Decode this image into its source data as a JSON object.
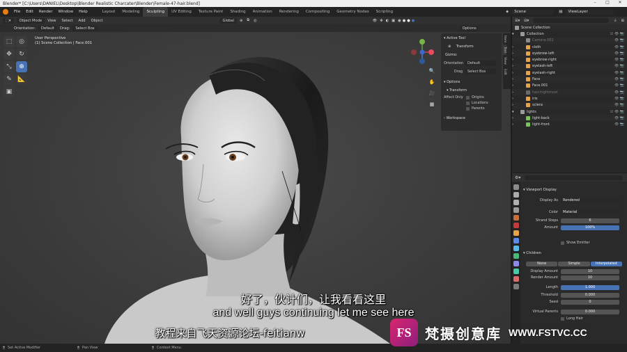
{
  "window": {
    "title": "Blender* [C:\\Users\\DANIEL\\Desktop\\Blender Realistic Charcater\\Blender\\Female-47-hair.blend]"
  },
  "menu": [
    "File",
    "Edit",
    "Render",
    "Window",
    "Help"
  ],
  "workspaces": [
    "Layout",
    "Modeling",
    "Sculpting",
    "UV Editing",
    "Texture Paint",
    "Shading",
    "Animation",
    "Rendering",
    "Compositing",
    "Geometry Nodes",
    "Scripting"
  ],
  "active_workspace": "Sculpting",
  "scene": {
    "scene_name": "Scene",
    "view_layer": "ViewLayer"
  },
  "viewport_header": {
    "mode": "Object Mode",
    "menus": [
      "View",
      "Select",
      "Add",
      "Object"
    ],
    "transform": "Global",
    "options": "Options",
    "orientation_label": "Orientation:",
    "orientation_value": "Default",
    "drag_label": "Drag:",
    "drag_value": "Select Box"
  },
  "viewport": {
    "perspective": "User Perspective",
    "collection": "(1) Scene Collection | Face.001"
  },
  "npanel": {
    "active_tool": "Active Tool",
    "transform": "Transform",
    "gizmo": "Gizmo:",
    "orientation_label": "Orientation",
    "orientation_value": "Default",
    "drag_label": "Drag",
    "drag_value": "Select Box",
    "options": "Options",
    "transform2": "Transform",
    "affect_only": "Affect Only",
    "origins": "Origins",
    "locations": "Locations",
    "parents": "Parents",
    "workspace": "Workspace",
    "tabs": [
      "Item",
      "Tool",
      "View",
      "Edit"
    ]
  },
  "outliner": {
    "header": "Scene Collection",
    "items": [
      {
        "label": "Scene Collection",
        "indent": 0,
        "color": "#9a9a9a"
      },
      {
        "label": "Collection",
        "indent": 1,
        "color": "#9a9a9a"
      },
      {
        "label": "Camera.001",
        "indent": 2,
        "color": "#8a8a8a"
      },
      {
        "label": "cloth",
        "indent": 2,
        "color": "#e8a24a"
      },
      {
        "label": "eyebrow-left",
        "indent": 2,
        "color": "#e8a24a"
      },
      {
        "label": "eyebrow-right",
        "indent": 2,
        "color": "#e8a24a"
      },
      {
        "label": "eyelash-left",
        "indent": 2,
        "color": "#e8a24a"
      },
      {
        "label": "eyelash-right",
        "indent": 2,
        "color": "#e8a24a"
      },
      {
        "label": "Face",
        "indent": 2,
        "color": "#e8a24a"
      },
      {
        "label": "Face.001",
        "indent": 2,
        "color": "#e8a24a"
      },
      {
        "label": "hair-hightmost",
        "indent": 2,
        "color": "#6a6a6a"
      },
      {
        "label": "iris",
        "indent": 2,
        "color": "#e8a24a"
      },
      {
        "label": "sclera",
        "indent": 2,
        "color": "#e8a24a"
      },
      {
        "label": "lights",
        "indent": 1,
        "color": "#9a9a9a"
      },
      {
        "label": "light-back",
        "indent": 2,
        "color": "#7ac45a"
      },
      {
        "label": "light-front",
        "indent": 2,
        "color": "#7ac45a"
      }
    ]
  },
  "properties": {
    "viewport_display": "Viewport Display",
    "display_as_label": "Display As",
    "display_as_value": "Rendered",
    "color_label": "Color",
    "color_value": "Material",
    "strand_steps_label": "Strand Steps",
    "strand_steps_value": "6",
    "amount_label": "Amount",
    "amount_value": "100%",
    "show_emitter": "Show Emitter",
    "children": "Children",
    "children_modes": [
      "None",
      "Simple",
      "Interpolated"
    ],
    "children_active": "Interpolated",
    "display_amount_label": "Display Amount",
    "display_amount_value": "10",
    "render_amount_label": "Render Amount",
    "render_amount_value": "10",
    "length_label": "Length",
    "length_value": "1.000",
    "threshold_label": "Threshold",
    "threshold_value": "0.000",
    "seed_label": "Seed",
    "seed_value": "0",
    "virtual_parents_label": "Virtual Parents",
    "virtual_parents_value": "0.000",
    "long_hair": "Long Hair"
  },
  "status": {
    "left": "Set Active Modifier",
    "middle": "Pan View",
    "right": "Context Menu"
  },
  "subtitles": {
    "zh": "好了，伙计们，让我看看这里",
    "en": "and well guys continuing let me see here",
    "source": "教程来自飞天资源论坛-feitianw"
  },
  "watermark": {
    "logo": "FS",
    "name": "梵摄创意库",
    "url": "WWW.FSTVC.CC"
  },
  "colors": {
    "accent": "#4772b3",
    "orange": "#e87d0d",
    "bg": "#3c3c3c"
  }
}
